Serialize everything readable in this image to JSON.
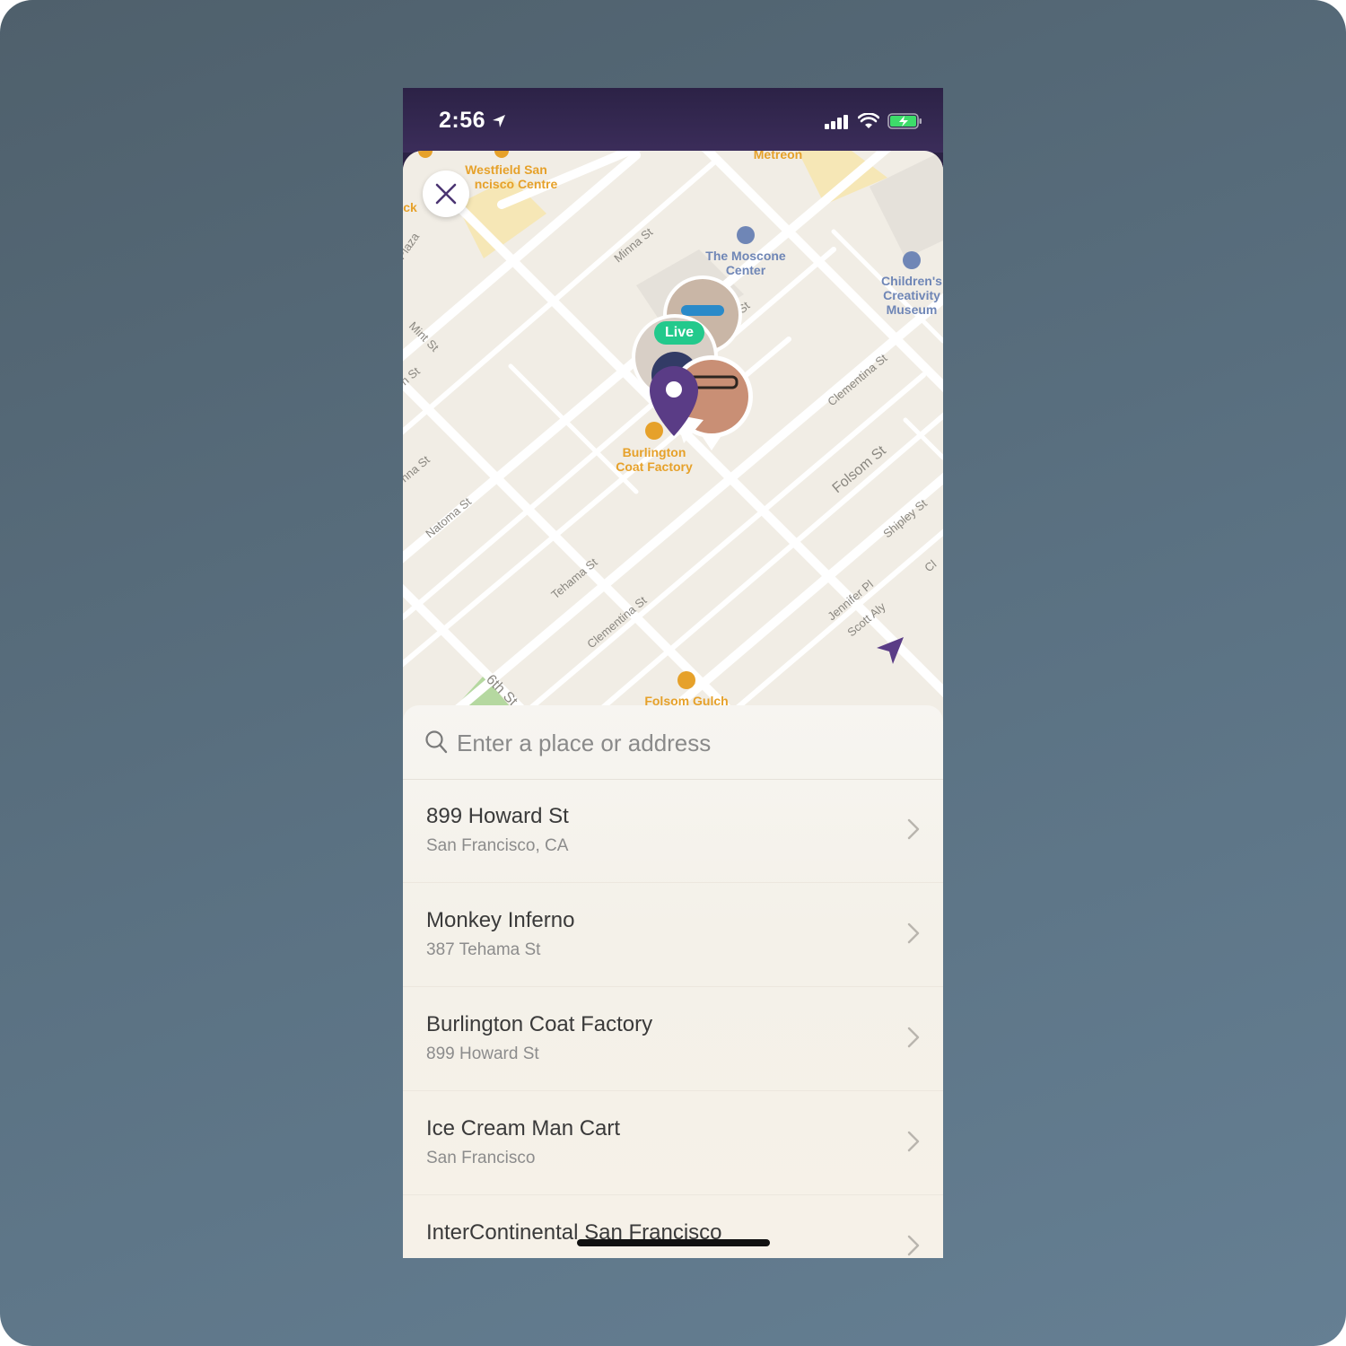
{
  "status_bar": {
    "time": "2:56"
  },
  "map": {
    "labels": {
      "westfield": "Westfield San",
      "westfield2": "ncisco Centre",
      "metreon": "Metreon",
      "moscone1": "The Moscone",
      "moscone2": "Center",
      "childrens1": "Children's",
      "childrens2": "Creativity",
      "childrens3": "Museum",
      "burlington1": "Burlington",
      "burlington2": "Coat Factory",
      "folsom_gulch": "Folsom Gulch",
      "minna": "Minna St",
      "natoma": "Natoma St",
      "tehama": "Tehama St",
      "clementina1": "Clementina St",
      "clementina2": "Clementina St",
      "folsom": "Folsom St",
      "shipley": "Shipley St",
      "jennifer": "Jennifer Pl",
      "scott": "Scott Aly",
      "sixth": "6th St",
      "plaza": "Plaza",
      "mint": "Mint St",
      "fifth": "h St",
      "minna_left": "nna St",
      "ck": "ck",
      "st_short": "St",
      "cl": "Cl"
    },
    "live_badge": "Live"
  },
  "search": {
    "placeholder": "Enter a place or address"
  },
  "results": [
    {
      "title": "899 Howard St",
      "subtitle": "San Francisco, CA"
    },
    {
      "title": "Monkey Inferno",
      "subtitle": "387 Tehama St"
    },
    {
      "title": "Burlington Coat Factory",
      "subtitle": "899 Howard St"
    },
    {
      "title": "Ice Cream Man Cart",
      "subtitle": "San Francisco"
    },
    {
      "title": "InterContinental San Francisco",
      "subtitle": ""
    }
  ],
  "colors": {
    "accent": "#5a3c86",
    "live": "#23c98c",
    "poi_orange": "#e6a12a",
    "poi_blue": "#6f86b6"
  }
}
